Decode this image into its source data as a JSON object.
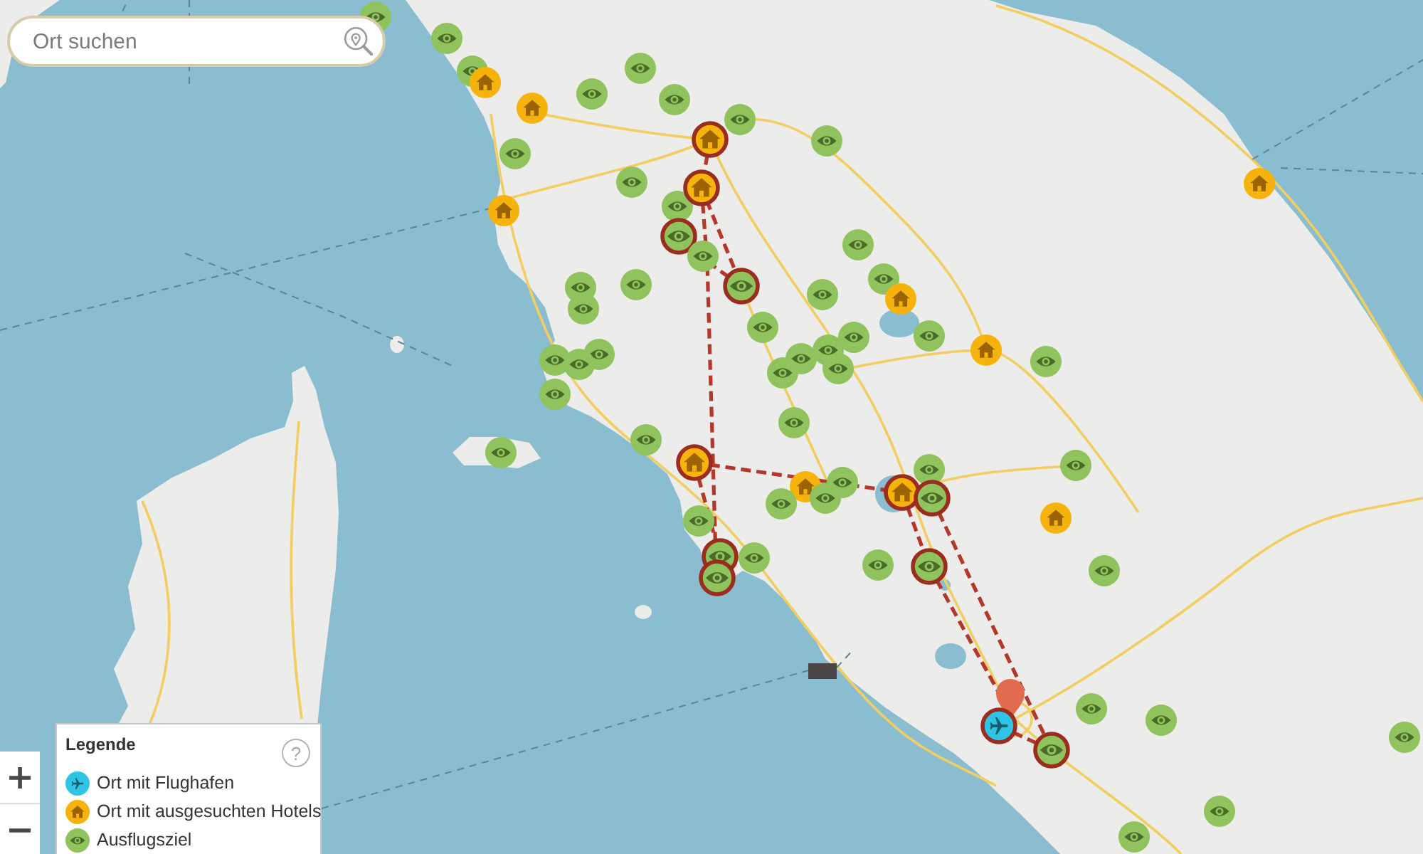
{
  "search": {
    "placeholder": "Ort suchen"
  },
  "markers": [
    {
      "kind": "excursion",
      "selected": false
    },
    {
      "kind": "excursion",
      "selected": false
    },
    {
      "kind": "excursion",
      "selected": false
    },
    {
      "kind": "hotel",
      "selected": false
    },
    {
      "kind": "hotel",
      "selected": false
    },
    {
      "kind": "excursion",
      "selected": false
    },
    {
      "kind": "excursion",
      "selected": false
    },
    {
      "kind": "excursion",
      "selected": false
    },
    {
      "kind": "excursion",
      "selected": false
    },
    {
      "kind": "hotel",
      "selected": true
    },
    {
      "kind": "excursion",
      "selected": false
    },
    {
      "kind": "excursion",
      "selected": false
    },
    {
      "kind": "excursion",
      "selected": false
    },
    {
      "kind": "excursion",
      "selected": false
    },
    {
      "kind": "hotel",
      "selected": true
    },
    {
      "kind": "hotel",
      "selected": false
    },
    {
      "kind": "excursion",
      "selected": true
    },
    {
      "kind": "excursion",
      "selected": false
    },
    {
      "kind": "excursion",
      "selected": true
    },
    {
      "kind": "excursion",
      "selected": false
    },
    {
      "kind": "excursion",
      "selected": false
    },
    {
      "kind": "excursion",
      "selected": false
    },
    {
      "kind": "hotel",
      "selected": false
    },
    {
      "kind": "excursion",
      "selected": false
    },
    {
      "kind": "excursion",
      "selected": false
    },
    {
      "kind": "excursion",
      "selected": false
    },
    {
      "kind": "excursion",
      "selected": false
    },
    {
      "kind": "excursion",
      "selected": false
    },
    {
      "kind": "excursion",
      "selected": false
    },
    {
      "kind": "hotel",
      "selected": false
    },
    {
      "kind": "excursion",
      "selected": false
    },
    {
      "kind": "hotel",
      "selected": false
    },
    {
      "kind": "excursion",
      "selected": false
    },
    {
      "kind": "excursion",
      "selected": false
    },
    {
      "kind": "excursion",
      "selected": false
    },
    {
      "kind": "excursion",
      "selected": false
    },
    {
      "kind": "excursion",
      "selected": false
    },
    {
      "kind": "excursion",
      "selected": false
    },
    {
      "kind": "excursion",
      "selected": false
    },
    {
      "kind": "excursion",
      "selected": false
    },
    {
      "kind": "excursion",
      "selected": false
    },
    {
      "kind": "excursion",
      "selected": false
    },
    {
      "kind": "excursion",
      "selected": false
    },
    {
      "kind": "hotel",
      "selected": true
    },
    {
      "kind": "excursion",
      "selected": false
    },
    {
      "kind": "hotel",
      "selected": false
    },
    {
      "kind": "excursion",
      "selected": false
    },
    {
      "kind": "excursion",
      "selected": false
    },
    {
      "kind": "excursion",
      "selected": false
    },
    {
      "kind": "hotel",
      "selected": true
    },
    {
      "kind": "excursion",
      "selected": true
    },
    {
      "kind": "excursion",
      "selected": false
    },
    {
      "kind": "hotel",
      "selected": false
    },
    {
      "kind": "excursion",
      "selected": false
    },
    {
      "kind": "excursion",
      "selected": false
    },
    {
      "kind": "excursion",
      "selected": true
    },
    {
      "kind": "excursion",
      "selected": true
    },
    {
      "kind": "excursion",
      "selected": false
    },
    {
      "kind": "excursion",
      "selected": true
    },
    {
      "kind": "excursion",
      "selected": false
    },
    {
      "kind": "excursion",
      "selected": false
    },
    {
      "kind": "excursion",
      "selected": false
    },
    {
      "kind": "airport",
      "selected": true
    },
    {
      "kind": "excursion",
      "selected": true
    },
    {
      "kind": "excursion",
      "selected": false
    },
    {
      "kind": "excursion",
      "selected": false
    },
    {
      "kind": "excursion",
      "selected": false
    }
  ],
  "legend": {
    "title": "Legende",
    "help": "?",
    "items": [
      {
        "kind": "airport",
        "label": "Ort mit Flughafen"
      },
      {
        "kind": "hotel",
        "label": "Ort mit ausgesuchten Hotels"
      },
      {
        "kind": "excursion",
        "label": "Ausflugsziel"
      }
    ]
  },
  "zoom_controls": [
    "+",
    "−"
  ]
}
